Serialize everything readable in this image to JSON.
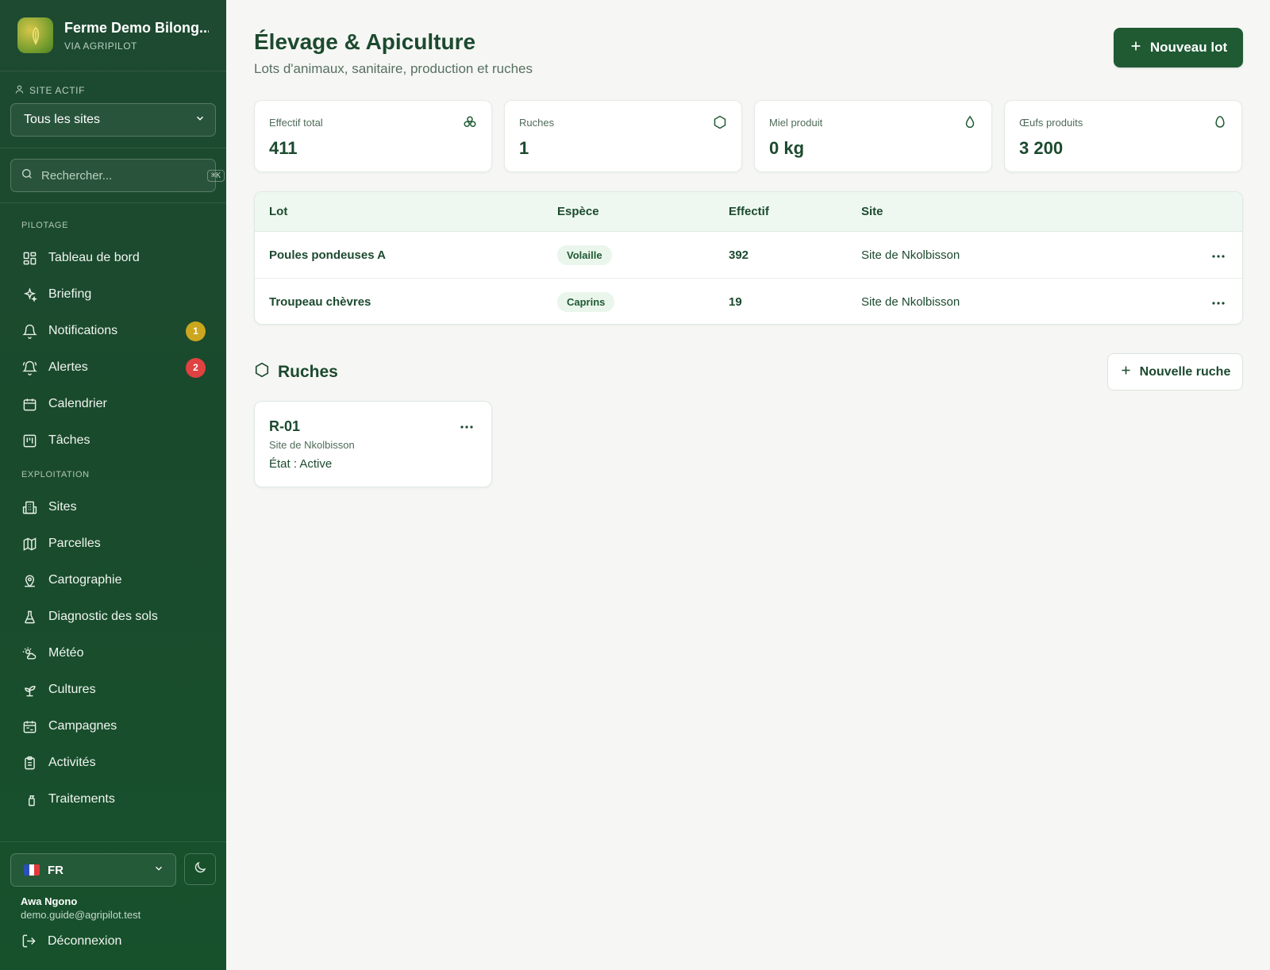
{
  "brand": {
    "name": "Ferme Demo Bilong...",
    "sub": "VIA AGRIPILOT"
  },
  "site_selector": {
    "label": "SITE ACTIF",
    "value": "Tous les sites"
  },
  "search": {
    "placeholder": "Rechercher...",
    "shortcut": "⌘K"
  },
  "nav": {
    "sections": {
      "pilotage": "PILOTAGE",
      "exploitation": "EXPLOITATION"
    },
    "items": [
      {
        "label": "Tableau de bord",
        "icon": "dashboard-icon"
      },
      {
        "label": "Briefing",
        "icon": "sparkles-icon"
      },
      {
        "label": "Notifications",
        "icon": "bell-icon",
        "badge": "1"
      },
      {
        "label": "Alertes",
        "icon": "bell-ring-icon",
        "badge": "2"
      },
      {
        "label": "Calendrier",
        "icon": "calendar-icon"
      },
      {
        "label": "Tâches",
        "icon": "kanban-icon"
      },
      {
        "label": "Sites",
        "icon": "building-icon"
      },
      {
        "label": "Parcelles",
        "icon": "map-icon"
      },
      {
        "label": "Cartographie",
        "icon": "map-pin-icon"
      },
      {
        "label": "Diagnostic des sols",
        "icon": "flask-icon"
      },
      {
        "label": "Météo",
        "icon": "sun-cloud-icon"
      },
      {
        "label": "Cultures",
        "icon": "sprout-icon"
      },
      {
        "label": "Campagnes",
        "icon": "calendar-range-icon"
      },
      {
        "label": "Activités",
        "icon": "clipboard-icon"
      },
      {
        "label": "Traitements",
        "icon": "spray-icon"
      }
    ]
  },
  "footer": {
    "language": "FR",
    "user_name": "Awa Ngono",
    "user_email": "demo.guide@agripilot.test",
    "logout": "Déconnexion"
  },
  "header": {
    "title": "Élevage & Apiculture",
    "subtitle": "Lots d'animaux, sanitaire, production et ruches",
    "new_lot": "Nouveau lot"
  },
  "stats": [
    {
      "label": "Effectif total",
      "value": "411",
      "icon": "group-icon"
    },
    {
      "label": "Ruches",
      "value": "1",
      "icon": "hexagon-icon"
    },
    {
      "label": "Miel produit",
      "value": "0 kg",
      "icon": "droplet-icon"
    },
    {
      "label": "Œufs produits",
      "value": "3 200",
      "icon": "egg-icon"
    }
  ],
  "table": {
    "columns": [
      "Lot",
      "Espèce",
      "Effectif",
      "Site"
    ],
    "rows": [
      {
        "lot": "Poules pondeuses A",
        "espece": "Volaille",
        "effectif": "392",
        "site": "Site de Nkolbisson"
      },
      {
        "lot": "Troupeau chèvres",
        "espece": "Caprins",
        "effectif": "19",
        "site": "Site de Nkolbisson"
      }
    ]
  },
  "hives_section": {
    "title": "Ruches",
    "new_hive": "Nouvelle ruche"
  },
  "hives": [
    {
      "name": "R-01",
      "site": "Site de Nkolbisson",
      "state": "État : Active"
    }
  ],
  "colors": {
    "sidebar": "#1d4a31",
    "primary": "#1f5a33",
    "badge_yellow": "#cba61e",
    "badge_red": "#e04141"
  }
}
